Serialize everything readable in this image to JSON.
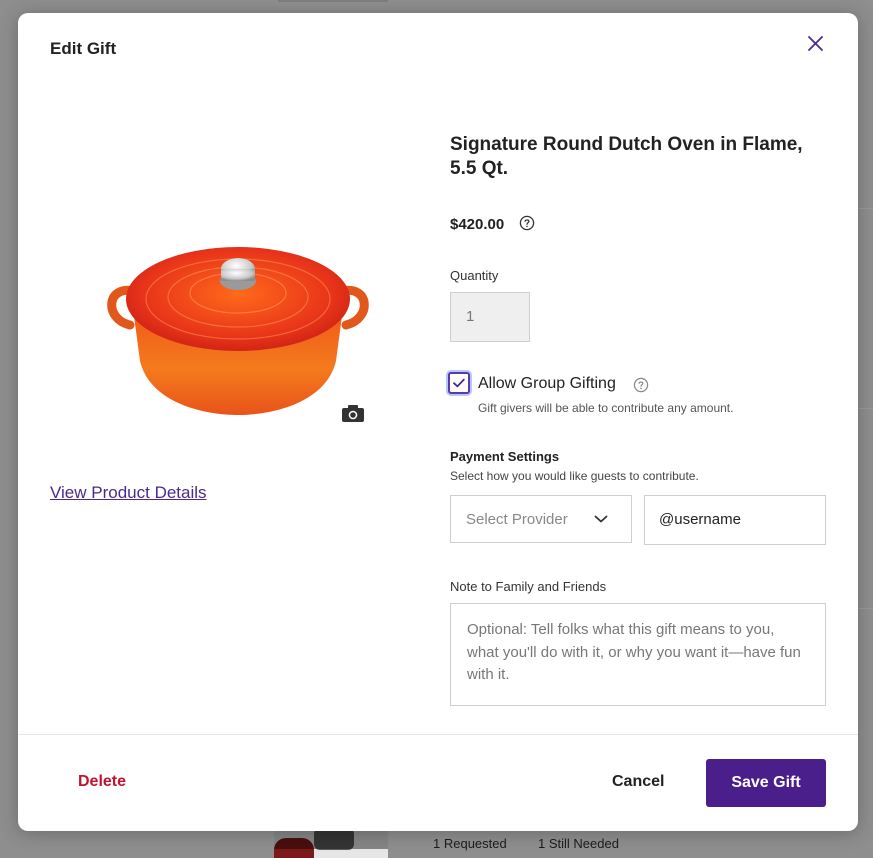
{
  "modal": {
    "title": "Edit Gift",
    "close_icon": "close-icon"
  },
  "product": {
    "name": "Signature Round Dutch Oven in Flame, 5.5 Qt.",
    "price": "$420.00",
    "image_icon": "dutch-oven-image",
    "camera_icon": "camera-icon",
    "view_details_label": "View Product Details"
  },
  "quantity": {
    "label": "Quantity",
    "value": "1"
  },
  "group_gifting": {
    "checked": true,
    "label": "Allow Group Gifting",
    "hint": "Gift givers will be able to contribute any amount."
  },
  "payment": {
    "title": "Payment Settings",
    "subtitle": "Select how you would like guests to contribute.",
    "provider_placeholder": "Select Provider",
    "username_value": "@username"
  },
  "note": {
    "label": "Note to Family and Friends",
    "placeholder": "Optional: Tell folks what this gift means to you, what you'll do with it, or why you want it—have fun with it."
  },
  "footer": {
    "delete_label": "Delete",
    "cancel_label": "Cancel",
    "save_label": "Save Gift"
  },
  "background": {
    "requested": "1 Requested",
    "still_needed": "1 Still Needed"
  },
  "colors": {
    "accent": "#4a1f8c",
    "delete": "#c0152f",
    "link": "#4a2a8c"
  }
}
